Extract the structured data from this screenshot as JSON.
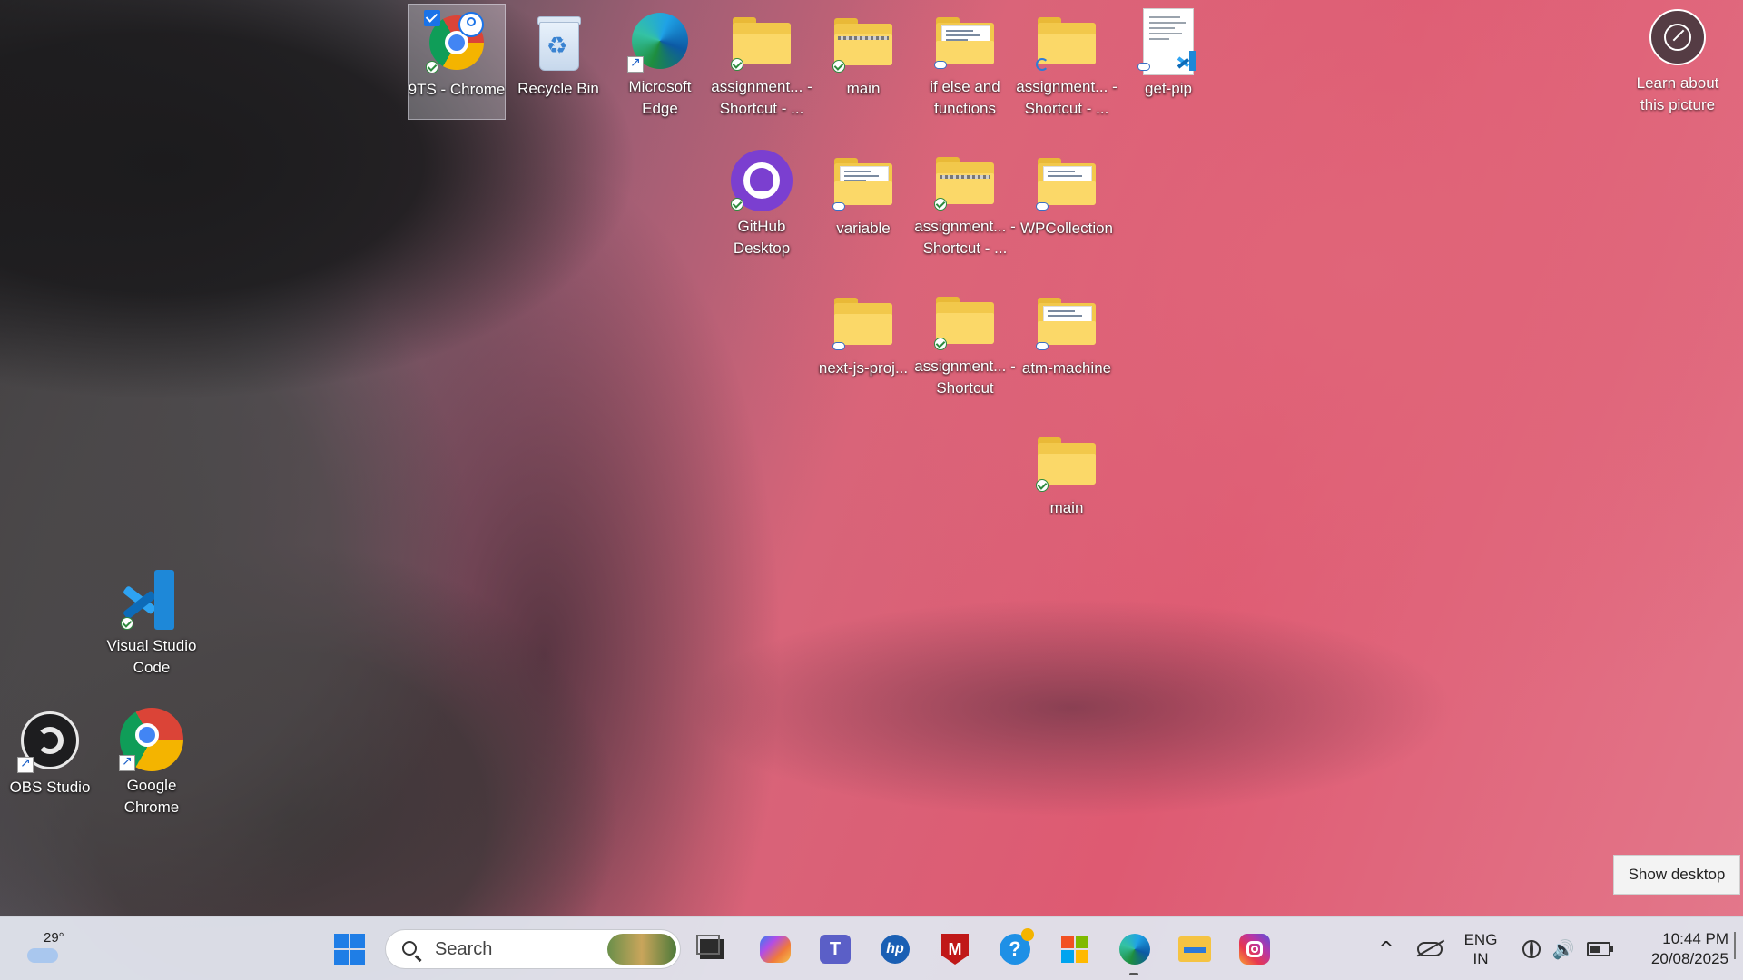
{
  "desktop": {
    "icons": {
      "chrome_9ts": "9TS - Chrome",
      "recycle_bin": "Recycle Bin",
      "edge": "Microsoft Edge",
      "assignment_shortcut_1": "assignment... - Shortcut - ...",
      "main_zip": "main",
      "if_else": "if else and functions",
      "assignment_shortcut_2": "assignment... - Shortcut - ...",
      "get_pip": "get-pip",
      "github_desktop": "GitHub Desktop",
      "variable": "variable",
      "assignment_shortcut_3": "assignment... - Shortcut - ...",
      "wpcollection": "WPCollection",
      "next_js": "next-js-proj...",
      "assignment_shortcut_4": "assignment... - Shortcut",
      "atm_machine": "atm-machine",
      "main_folder": "main",
      "vscode": "Visual Studio Code",
      "obs": "OBS Studio",
      "google_chrome": "Google Chrome"
    },
    "learn_about": "Learn about this picture",
    "tooltip": "Show desktop"
  },
  "taskbar": {
    "weather_temp": "29°",
    "search_placeholder": "Search",
    "language_line1": "ENG",
    "language_line2": "IN",
    "time": "10:44 PM",
    "date": "20/08/2025",
    "teams_glyph": "T",
    "hp_glyph": "hp",
    "mcafee_glyph": "M",
    "help_glyph": "?",
    "chevron_glyph": "^",
    "volume_glyph": "🔊"
  },
  "colors": {
    "accent": "#1f7ee6",
    "folder_yellow": "#fbd868",
    "taskbar_bg": "#e0e3ec"
  }
}
